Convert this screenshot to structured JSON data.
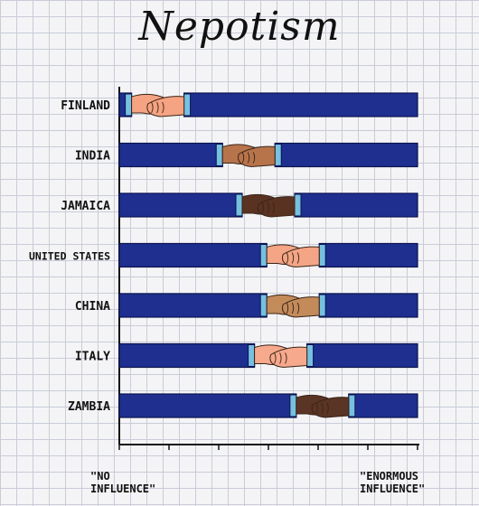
{
  "chart_data": {
    "type": "bar",
    "title": "Nepotism",
    "categories": [
      "FINLAND",
      "INDIA",
      "JAMAICA",
      "UNITED STATES",
      "CHINA",
      "ITALY",
      "ZAMBIA"
    ],
    "values": [
      0.05,
      0.42,
      0.5,
      0.6,
      0.6,
      0.55,
      0.72
    ],
    "skin_colors": [
      "#f5a382",
      "#b7744a",
      "#5a3222",
      "#f3a585",
      "#c38a5a",
      "#f6a98c",
      "#5a3424"
    ],
    "sleeve_color": "#1f2f8f",
    "cuff_color": "#76c0e0",
    "xlim": [
      0,
      1
    ],
    "x_min_label": "\"NO\nINFLUENCE\"",
    "x_max_label": "\"ENORMOUS\nINFLUENCE\""
  }
}
